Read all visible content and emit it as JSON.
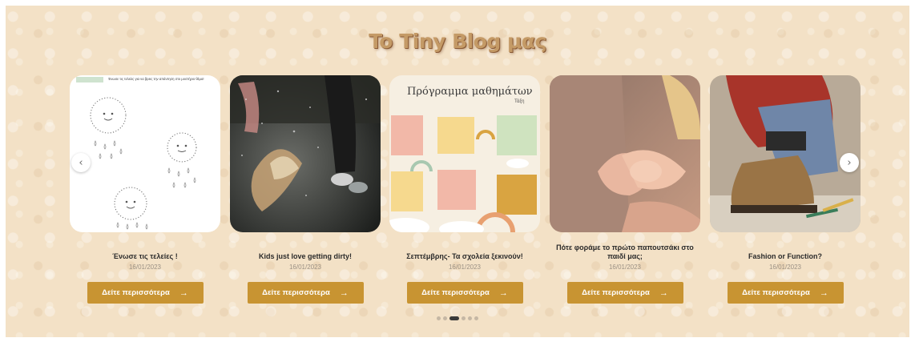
{
  "section": {
    "title": "To Tiny Blog μας"
  },
  "posts": [
    {
      "title": "Ένωσε τις τελείες !",
      "date": "16/01/2023",
      "button": "Δείτε περισσότερα",
      "image_text": "Ένωσε τις τελείες για να βρεις την απάντηση στο μυστήριο θέμα!"
    },
    {
      "title": "Kids just love getting dirty!",
      "date": "16/01/2023",
      "button": "Δείτε περισσότερα"
    },
    {
      "title": "Σεπτέμβρης- Τα σχολεία ξεκινούν!",
      "date": "16/01/2023",
      "button": "Δείτε περισσότερα",
      "image_text": "Πρόγραμμα μαθημάτων",
      "image_subtext": "Τάξη"
    },
    {
      "title": "Πότε φοράμε το πρώτο παπουτσάκι στο παιδί μας;",
      "date": "16/01/2023",
      "button": "Δείτε περισσότερα"
    },
    {
      "title": "Fashion or Function?",
      "date": "16/01/2023",
      "button": "Δείτε περισσότερα"
    }
  ],
  "arrow_glyph": "→",
  "nav": {
    "prev": "‹",
    "next": "›"
  },
  "pagination": {
    "count": 6,
    "active_index": 2
  },
  "colors": {
    "background": "#f3e1c6",
    "title": "#c49a66",
    "button": "#c89432",
    "button_text": "#ffffff"
  }
}
